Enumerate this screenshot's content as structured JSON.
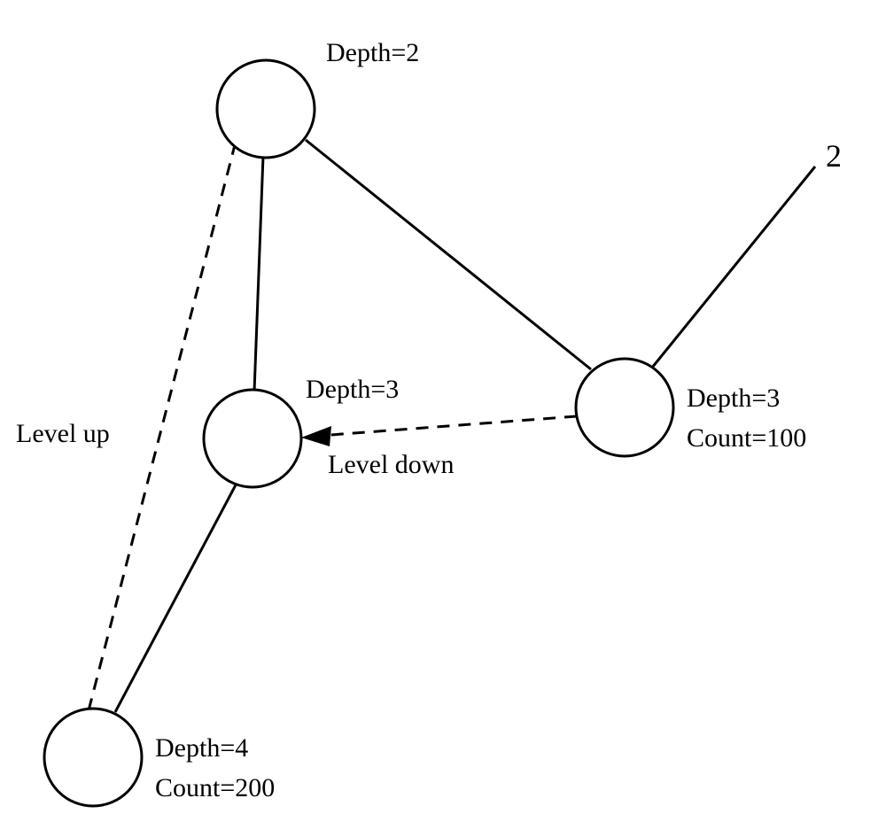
{
  "nodes": {
    "top": {
      "label_line1": "Depth=2"
    },
    "mid": {
      "label_line1": "Depth=3"
    },
    "right": {
      "label_line1": "Depth=3",
      "label_line2": "Count=100"
    },
    "bottom": {
      "label_line1": "Depth=4",
      "label_line2": "Count=200"
    }
  },
  "edges": {
    "level_up": {
      "label": "Level up"
    },
    "level_down": {
      "label": "Level down"
    }
  },
  "callout": {
    "label": "2"
  }
}
